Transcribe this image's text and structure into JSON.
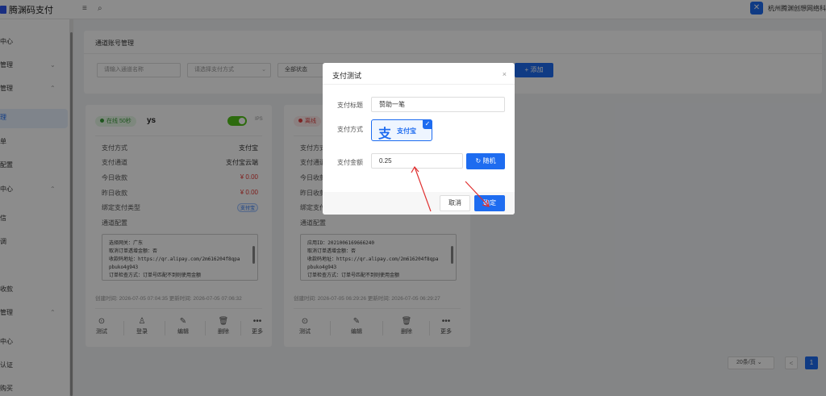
{
  "header": {
    "app_title": "腾渊码支付",
    "company": "杭州腾渊创想网络科"
  },
  "sidebar": {
    "items": [
      {
        "label": "中心",
        "chevron": ""
      },
      {
        "label": "管理",
        "chevron": "⌄"
      },
      {
        "label": "管理",
        "chevron": "⌃"
      },
      {
        "label": "理",
        "chevron": "",
        "active": true
      },
      {
        "label": "单",
        "chevron": ""
      },
      {
        "label": "配置",
        "chevron": ""
      },
      {
        "label": "中心",
        "chevron": "⌃"
      },
      {
        "label": "信",
        "chevron": ""
      },
      {
        "label": "调",
        "chevron": ""
      },
      {
        "label": "收款",
        "chevron": ""
      },
      {
        "label": "管理",
        "chevron": "⌃"
      },
      {
        "label": "中心",
        "chevron": ""
      },
      {
        "label": "认证",
        "chevron": ""
      },
      {
        "label": "购买",
        "chevron": ""
      }
    ]
  },
  "page": {
    "panel_title": "通道账号管理",
    "filters": {
      "name_placeholder": "请输入通道名称",
      "method_placeholder": "请选择支付方式",
      "status_value": "全部状态"
    },
    "add_label": "+ 添加"
  },
  "cards": [
    {
      "status": "在线 50秒",
      "name": "ys",
      "toggle_label": "IPS",
      "rows": [
        {
          "label": "支付方式",
          "value": "支付宝"
        },
        {
          "label": "支付通道",
          "value": "支付宝云端"
        },
        {
          "label": "今日收款",
          "value": "¥ 0.00"
        },
        {
          "label": "昨日收款",
          "value": "¥ 0.00"
        },
        {
          "label": "绑定支付类型",
          "value": "支付宝"
        }
      ],
      "config_label": "通道配置",
      "config_lines": [
        "选择网关：广东",
        "取消订单透增金额：否",
        "收款码地址：https://qr.alipay.com/2m616204f8qpa",
        "pbuko4g943",
        "订单检查方式：订单号匹配不到则使用金额"
      ],
      "times": "创建时间: 2026-07-05 07:04:35 更新时间: 2026-07-05 07:06:32",
      "actions": [
        "测试",
        "登录",
        "编辑",
        "删除",
        "更多"
      ]
    },
    {
      "status": "离线",
      "name": "",
      "rows": [
        {
          "label": "支付方式",
          "value": ""
        },
        {
          "label": "支付通道",
          "value": ""
        },
        {
          "label": "今日收款",
          "value": ""
        },
        {
          "label": "昨日收款",
          "value": ""
        },
        {
          "label": "绑定支付",
          "value": ""
        }
      ],
      "config_label": "通道配置",
      "config_lines": [
        "应用ID：2021006169666240",
        "取消订单透增金额：否",
        "收款码地址：https://qr.alipay.com/2m616204f8qpa",
        "pbuko4g943",
        "订单检查方式：订单号匹配不到则使用金额"
      ],
      "times": "创建时间: 2026-07-05 06:29:26 更新时间: 2026-07-05 06:29:27",
      "actions": [
        "测试",
        "编辑",
        "删除",
        "更多"
      ]
    }
  ],
  "pager": {
    "page_size": "20条/页",
    "prev": "<",
    "current": "1"
  },
  "modal": {
    "title": "支付测试",
    "close": "×",
    "subject_label": "支付标题",
    "subject_value": "赞助一笔",
    "method_label": "支付方式",
    "method_option": "支付宝",
    "method_mark": "支",
    "amount_label": "支付金额",
    "amount_value": "0.25",
    "random_label": "随机",
    "cancel_label": "取消",
    "ok_label": "确定"
  },
  "colors": {
    "primary": "#1e6cf0",
    "online": "#3a9b3a",
    "offline": "#e04040",
    "amount_red": "#e53935",
    "annotation_arrow": "#e03030"
  }
}
